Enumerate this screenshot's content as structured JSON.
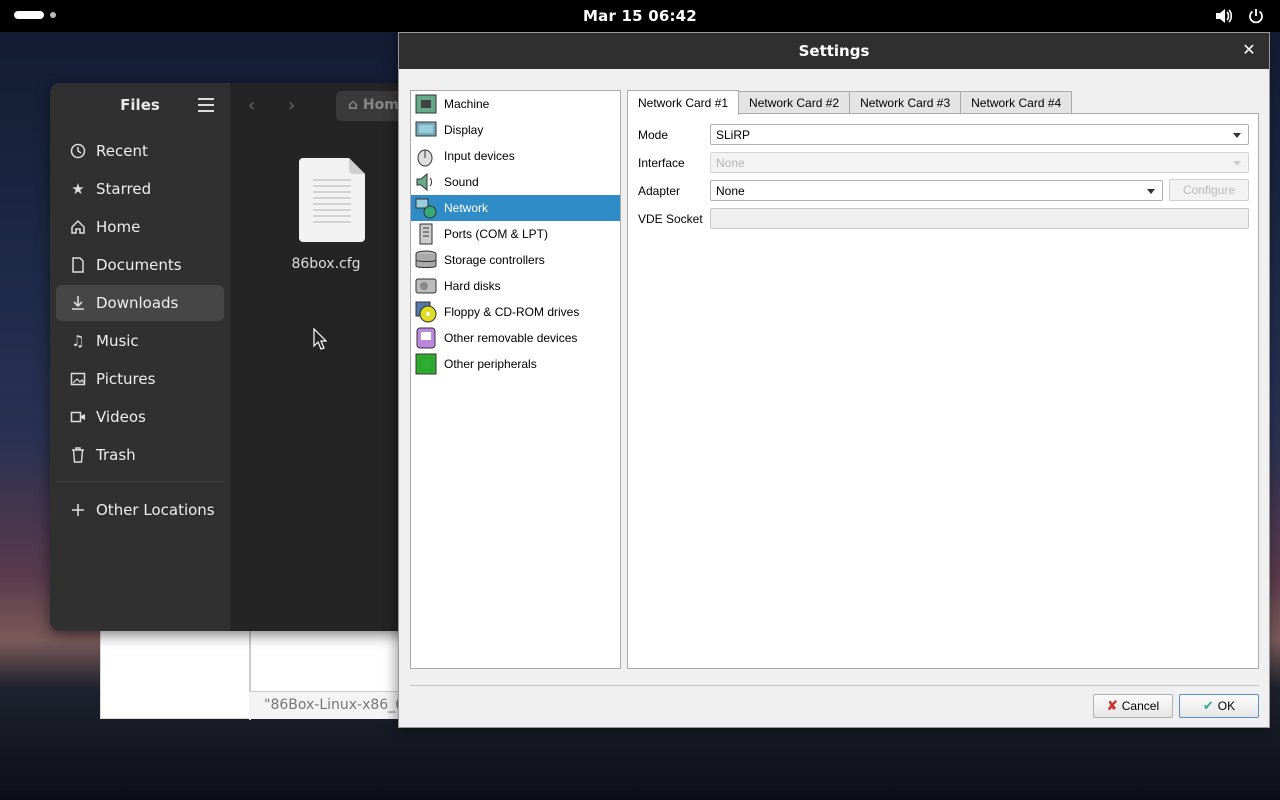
{
  "topbar": {
    "clock": "Mar 15  06:42",
    "tray_icons": [
      "volume-icon",
      "power-icon"
    ]
  },
  "background_window": {
    "field_text": "\"86Box-Linux-x86_6"
  },
  "files": {
    "title": "Files",
    "path_label": "Hom",
    "places": [
      {
        "label": "Recent",
        "icon": "clock-icon"
      },
      {
        "label": "Starred",
        "icon": "star-icon"
      },
      {
        "label": "Home",
        "icon": "home-icon"
      },
      {
        "label": "Documents",
        "icon": "document-icon"
      },
      {
        "label": "Downloads",
        "icon": "download-icon",
        "active": true
      },
      {
        "label": "Music",
        "icon": "music-icon"
      },
      {
        "label": "Pictures",
        "icon": "picture-icon"
      },
      {
        "label": "Videos",
        "icon": "video-icon"
      },
      {
        "label": "Trash",
        "icon": "trash-icon"
      }
    ],
    "other_locations": "Other Locations",
    "file": {
      "name": "86box.cfg"
    }
  },
  "settings": {
    "title": "Settings",
    "categories": [
      {
        "label": "Machine",
        "icon": "machine-icon"
      },
      {
        "label": "Display",
        "icon": "display-icon"
      },
      {
        "label": "Input devices",
        "icon": "input-devices-icon"
      },
      {
        "label": "Sound",
        "icon": "sound-icon"
      },
      {
        "label": "Network",
        "icon": "network-icon",
        "selected": true
      },
      {
        "label": "Ports (COM & LPT)",
        "icon": "ports-icon"
      },
      {
        "label": "Storage controllers",
        "icon": "storage-icon"
      },
      {
        "label": "Hard disks",
        "icon": "hard-disk-icon"
      },
      {
        "label": "Floppy & CD-ROM drives",
        "icon": "floppy-cdrom-icon"
      },
      {
        "label": "Other removable devices",
        "icon": "removable-icon"
      },
      {
        "label": "Other peripherals",
        "icon": "peripherals-icon"
      }
    ],
    "tabs": [
      "Network Card #1",
      "Network Card #2",
      "Network Card #3",
      "Network Card #4"
    ],
    "active_tab": 0,
    "form": {
      "mode_label": "Mode",
      "mode_value": "SLiRP",
      "interface_label": "Interface",
      "interface_value": "None",
      "adapter_label": "Adapter",
      "adapter_value": "None",
      "configure_label": "Configure",
      "vde_label": "VDE Socket",
      "vde_value": ""
    },
    "buttons": {
      "cancel": "Cancel",
      "ok": "OK"
    },
    "colors": {
      "selection": "#308cc6"
    }
  }
}
